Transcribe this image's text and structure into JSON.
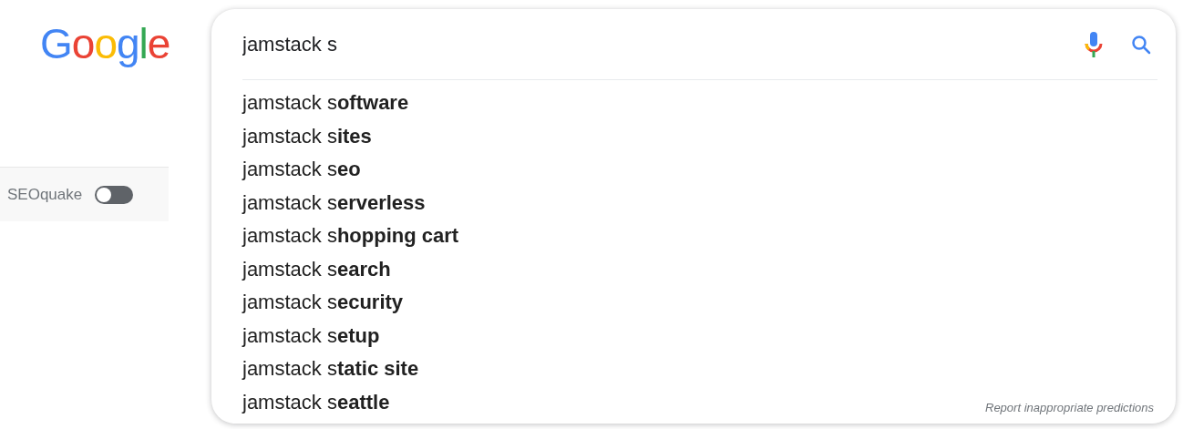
{
  "logo": {
    "text": "Google"
  },
  "search": {
    "value": "jamstack s"
  },
  "suggestions": [
    "jamstack s**oftware**",
    "jamstack s**ites**",
    "jamstack s**eo**",
    "jamstack s**erverless**",
    "jamstack s**hopping cart**",
    "jamstack s**earch**",
    "jamstack s**ecurity**",
    "jamstack s**etup**",
    "jamstack s**tatic site**",
    "jamstack s**eattle**"
  ],
  "report_link": "Report inappropriate predictions",
  "extension": {
    "label": "SEOquake",
    "on": false
  }
}
